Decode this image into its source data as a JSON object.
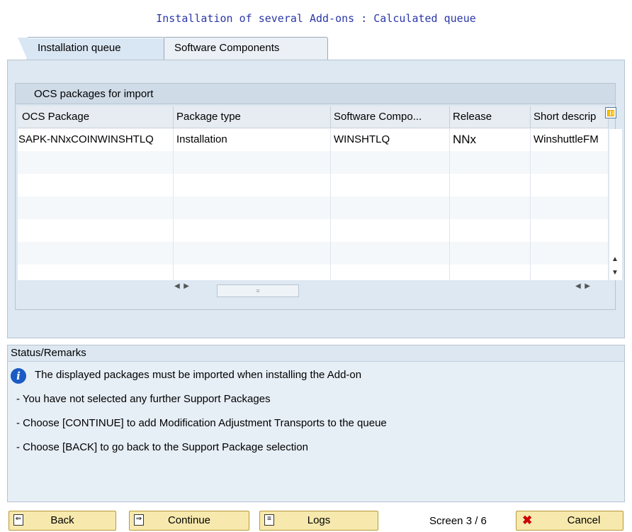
{
  "window": {
    "title": "Installation of several Add-ons : Calculated queue"
  },
  "tabs": [
    {
      "label": "Installation queue",
      "active": true
    },
    {
      "label": "Software Components",
      "active": false
    }
  ],
  "packages": {
    "group_title": "OCS packages for import",
    "columns": [
      "OCS Package",
      "Package type",
      "Software Compo...",
      "Release",
      "Short descrip"
    ],
    "rows": [
      [
        "SAPK-NNxCOINWINSHTLQ",
        "Installation",
        "WINSHTLQ",
        "NNx",
        "WinshuttleFM"
      ]
    ]
  },
  "status": {
    "title": "Status/Remarks",
    "icon": "info-icon",
    "messages": [
      "The displayed packages must be imported when installing the Add-on",
      "- You have not selected any further Support Packages",
      "- Choose [CONTINUE] to add Modification Adjustment Transports to the queue",
      "- Choose [BACK] to go back to the Support Package selection"
    ]
  },
  "footer": {
    "back": "Back",
    "continue": "Continue",
    "logs": "Logs",
    "screen": "Screen 3 / 6",
    "cancel": "Cancel"
  },
  "colors": {
    "title": "#2b37a8",
    "button": "#f7e9ad",
    "panel": "#dde8f2"
  }
}
